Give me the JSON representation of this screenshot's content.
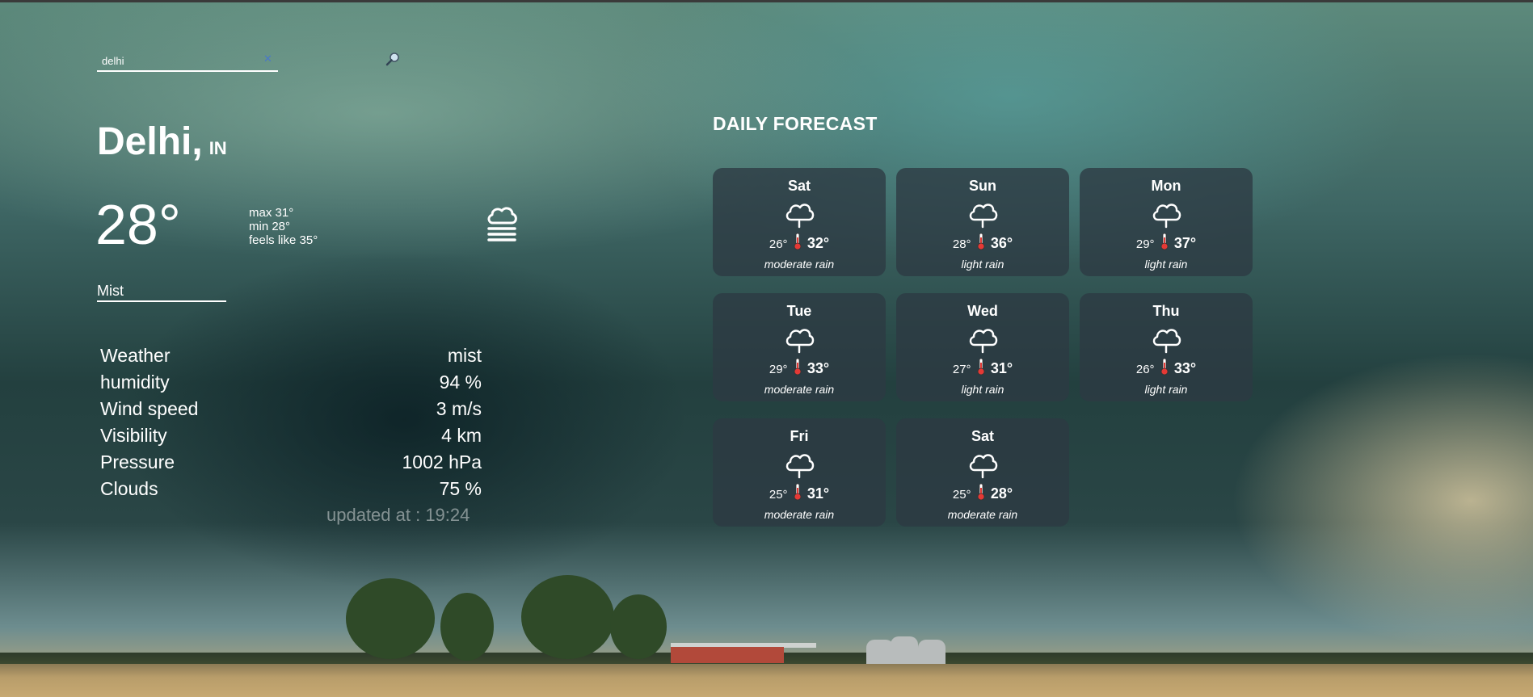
{
  "search": {
    "value": "delhi",
    "clear_icon": "close-icon",
    "button_icon": "magnifier-icon"
  },
  "current": {
    "city": "Delhi,",
    "country": "IN",
    "temp": "28°",
    "max": "max 31°",
    "min": "min 28°",
    "feels_like": "feels like 35°",
    "icon": "mist-icon",
    "description": "Mist"
  },
  "details": [
    {
      "label": "Weather",
      "value": "mist"
    },
    {
      "label": "humidity",
      "value": "94 %"
    },
    {
      "label": "Wind speed",
      "value": "3 m/s"
    },
    {
      "label": "Visibility",
      "value": "4 km"
    },
    {
      "label": "Pressure",
      "value": "1002 hPa"
    },
    {
      "label": "Clouds",
      "value": "75 %"
    }
  ],
  "updated": "updated at : 19:24",
  "forecast": {
    "title": "DAILY FORECAST",
    "days": [
      {
        "day": "Sat",
        "min": "26°",
        "max": "32°",
        "desc": "moderate rain",
        "icon": "cloud-rain-icon"
      },
      {
        "day": "Sun",
        "min": "28°",
        "max": "36°",
        "desc": "light rain",
        "icon": "cloud-rain-icon"
      },
      {
        "day": "Mon",
        "min": "29°",
        "max": "37°",
        "desc": "light rain",
        "icon": "cloud-rain-icon"
      },
      {
        "day": "Tue",
        "min": "29°",
        "max": "33°",
        "desc": "moderate rain",
        "icon": "cloud-rain-icon"
      },
      {
        "day": "Wed",
        "min": "27°",
        "max": "31°",
        "desc": "light rain",
        "icon": "cloud-rain-icon"
      },
      {
        "day": "Thu",
        "min": "26°",
        "max": "33°",
        "desc": "light rain",
        "icon": "cloud-rain-icon"
      },
      {
        "day": "Fri",
        "min": "25°",
        "max": "31°",
        "desc": "moderate rain",
        "icon": "cloud-rain-icon"
      },
      {
        "day": "Sat",
        "min": "25°",
        "max": "28°",
        "desc": "moderate rain",
        "icon": "cloud-rain-icon"
      }
    ]
  }
}
